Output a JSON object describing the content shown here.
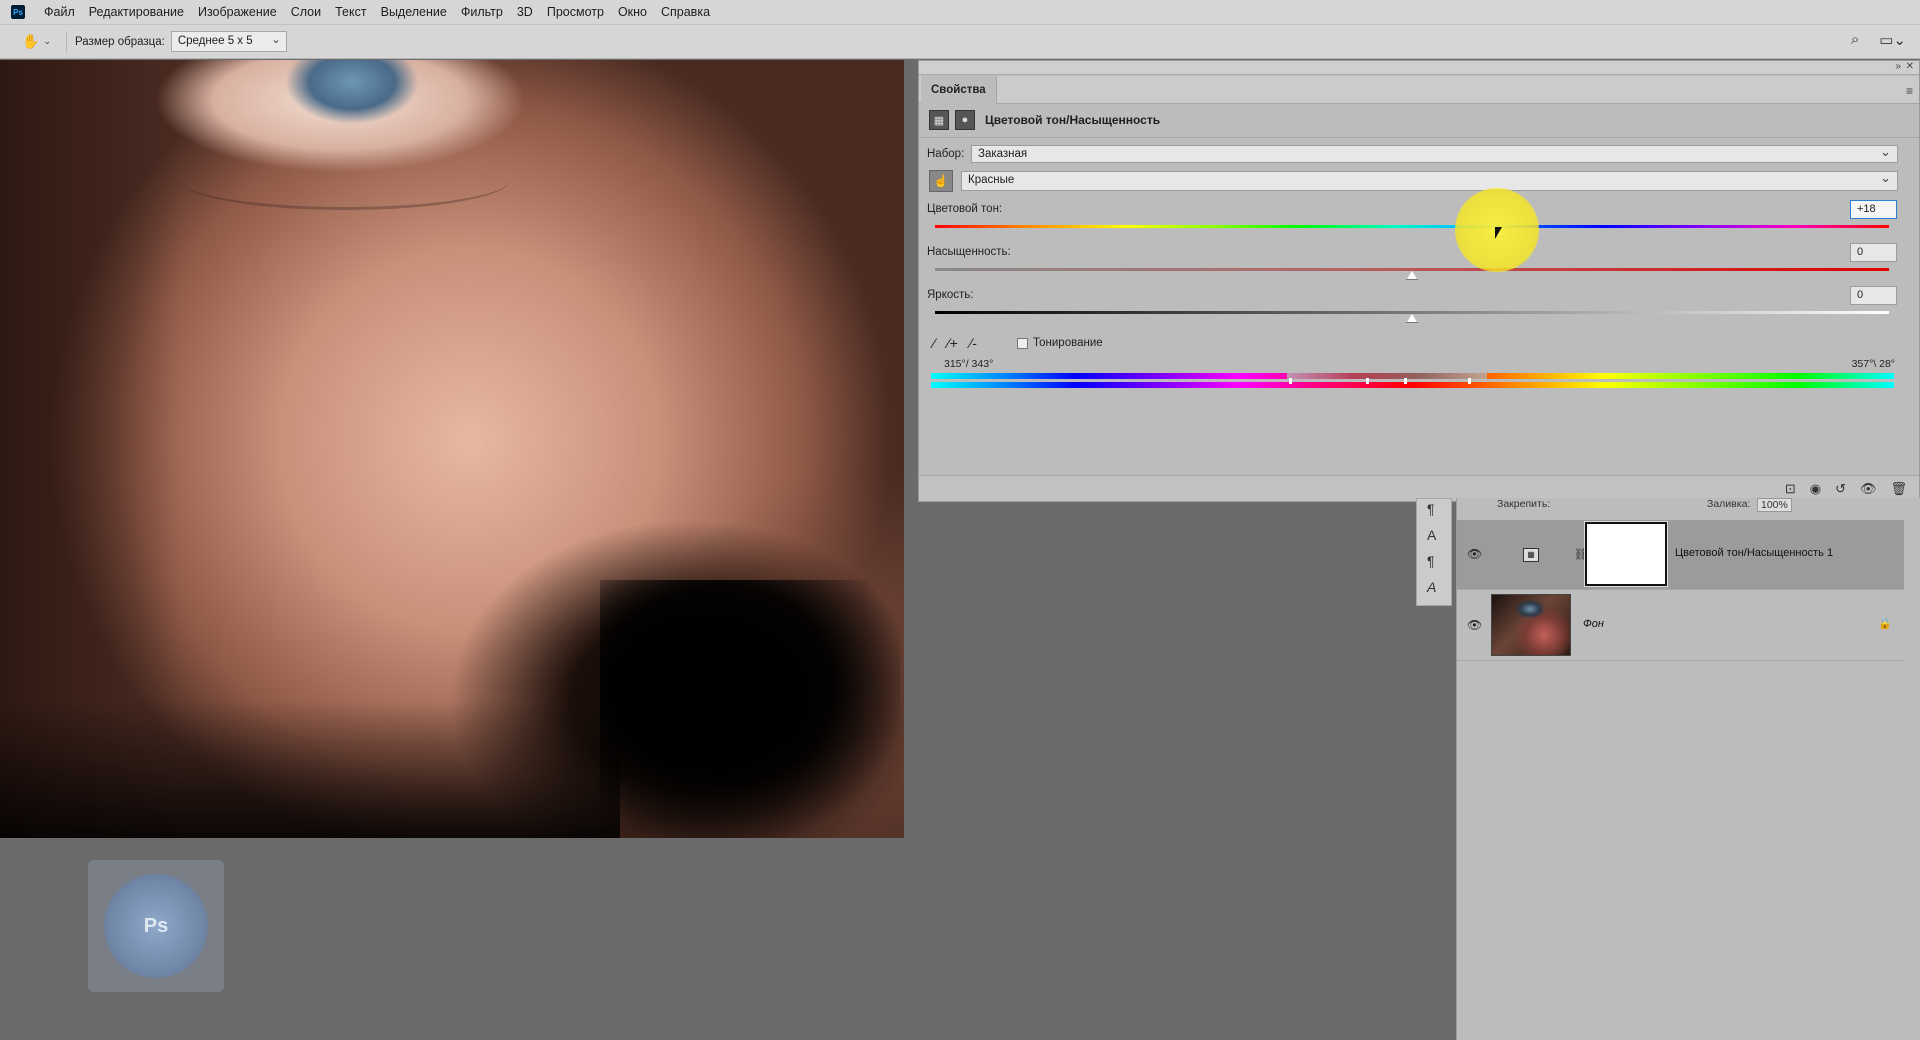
{
  "menubar": {
    "logo": "Ps",
    "items": [
      "Файл",
      "Редактирование",
      "Изображение",
      "Слои",
      "Текст",
      "Выделение",
      "Фильтр",
      "3D",
      "Просмотр",
      "Окно",
      "Справка"
    ]
  },
  "optionsbar": {
    "sample_size_label": "Размер образца:",
    "sample_size_value": "Среднее 5 х 5"
  },
  "properties": {
    "tab_label": "Свойства",
    "title": "Цветовой тон/Насыщенность",
    "preset_label": "Набор:",
    "preset_value": "Заказная",
    "channel_value": "Красные",
    "hue_label": "Цветовой тон:",
    "hue_value": "+18",
    "hue_position": 0.59,
    "saturation_label": "Насыщенность:",
    "saturation_value": "0",
    "saturation_position": 0.5,
    "lightness_label": "Яркость:",
    "lightness_value": "0",
    "lightness_position": 0.5,
    "colorize_label": "Тонирование",
    "colorize_checked": false,
    "range_left": "315°/ 343°",
    "range_right": "357°\\ 28°"
  },
  "layers": {
    "lock_label": "Закрепить:",
    "fill_label": "Заливка:",
    "fill_value": "100%",
    "items": [
      {
        "name": "Цветовой тон/Насыщенность 1",
        "selected": true,
        "type": "adjustment"
      },
      {
        "name": "Фон",
        "selected": false,
        "type": "background",
        "locked": true
      }
    ]
  },
  "colors": {
    "ui_bg": "#d6d6d6",
    "panel_bg": "#bcbcbc",
    "workspace_bg": "#6b6b6b",
    "accent_focus": "#2d7fd6",
    "cursor_highlight": "#f5e32a"
  },
  "icons": {
    "tools": [
      "move-icon",
      "lasso-ellipse-icon",
      "polygonal-lasso-icon",
      "magic-wand-icon",
      "crop-icon",
      "eyedropper-icon",
      "healing-brush-icon",
      "brush-icon",
      "stamp-icon",
      "history-brush-icon",
      "eraser-icon",
      "gradient-icon",
      "blur-icon",
      "dodge-icon",
      "pen-icon",
      "type-icon",
      "path-selection-icon",
      "rectangle-icon",
      "hand-icon",
      "zoom-icon",
      "more-icon"
    ]
  }
}
